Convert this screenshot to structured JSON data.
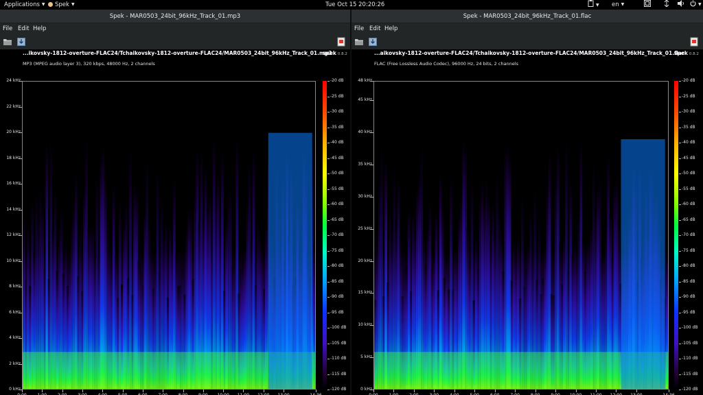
{
  "topbar": {
    "applications": "Applications",
    "app_name": "Spek",
    "clock": "Tue Oct 15  20:20:26",
    "language": "en"
  },
  "windows": [
    {
      "title": "Spek - MAR0503_24bit_96kHz_Track_01.mp3",
      "menu": [
        "File",
        "Edit",
        "Help"
      ],
      "file_path": "...ikovsky-1812-overture-FLAC24/Tchaikovsky-1812-overture-FLAC24/MAR0503_24bit_96kHz_Track_01.mp3",
      "file_info": "MP3 (MPEG audio layer 3), 320 kbps, 48000 Hz, 2 channels",
      "brand": "spek",
      "version": "0.8.2",
      "y_ticks": [
        "24 kHz",
        "22 kHz",
        "20 kHz",
        "18 kHz",
        "16 kHz",
        "14 kHz",
        "12 kHz",
        "10 kHz",
        "8 kHz",
        "6 kHz",
        "4 kHz",
        "2 kHz",
        "0 kHz"
      ],
      "x_ticks": [
        "0:00",
        "1:00",
        "2:00",
        "3:00",
        "4:00",
        "5:00",
        "6:00",
        "7:00",
        "8:00",
        "9:00",
        "10:00",
        "11:00",
        "12:00",
        "13:00",
        "14:36"
      ],
      "db_ticks": [
        "-20 dB",
        "-25 dB",
        "-30 dB",
        "-35 dB",
        "-40 dB",
        "-45 dB",
        "-50 dB",
        "-55 dB",
        "-60 dB",
        "-65 dB",
        "-70 dB",
        "-75 dB",
        "-80 dB",
        "-85 dB",
        "-90 dB",
        "-95 dB",
        "-100 dB",
        "-105 dB",
        "-110 dB",
        "-115 dB",
        "-120 dB"
      ],
      "max_freq_khz": 24,
      "cutoff_khz": 20,
      "duration_s": 876
    },
    {
      "title": "Spek - MAR0503_24bit_96kHz_Track_01.flac",
      "menu": [
        "File",
        "Edit",
        "Help"
      ],
      "file_path": "...aikovsky-1812-overture-FLAC24/Tchaikovsky-1812-overture-FLAC24/MAR0503_24bit_96kHz_Track_01.flac",
      "file_info": "FLAC (Free Lossless Audio Codec), 96000 Hz, 24 bits, 2 channels",
      "brand": "spek",
      "version": "0.8.2",
      "y_ticks": [
        "48 kHz",
        "45 kHz",
        "40 kHz",
        "35 kHz",
        "30 kHz",
        "25 kHz",
        "20 kHz",
        "15 kHz",
        "10 kHz",
        "5 kHz",
        "0 kHz"
      ],
      "x_ticks": [
        "0:00",
        "1:00",
        "2:00",
        "3:00",
        "4:00",
        "5:00",
        "6:00",
        "7:00",
        "8:00",
        "9:00",
        "10:00",
        "11:00",
        "12:00",
        "13:00",
        "14:36"
      ],
      "db_ticks": [
        "-20 dB",
        "-25 dB",
        "-30 dB",
        "-35 dB",
        "-40 dB",
        "-45 dB",
        "-50 dB",
        "-55 dB",
        "-60 dB",
        "-65 dB",
        "-70 dB",
        "-75 dB",
        "-80 dB",
        "-85 dB",
        "-90 dB",
        "-95 dB",
        "-100 dB",
        "-105 dB",
        "-110 dB",
        "-115 dB",
        "-120 dB"
      ],
      "max_freq_khz": 48,
      "cutoff_khz": 39,
      "duration_s": 876
    }
  ],
  "colors": {
    "accent": "#2a78d4",
    "spectrum_low": "#1030ff",
    "spectrum_mid": "#00ff40",
    "spectrum_high": "#ffff00"
  }
}
